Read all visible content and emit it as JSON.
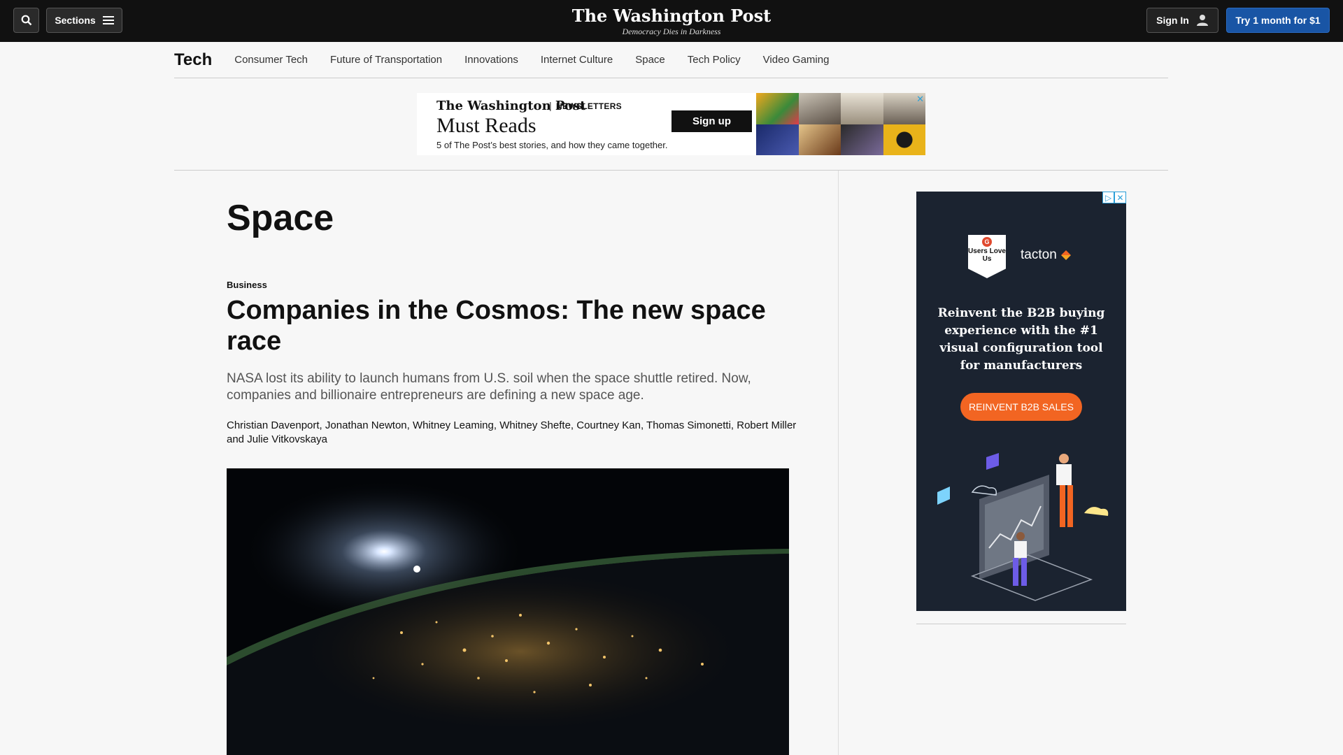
{
  "topbar": {
    "sections_label": "Sections",
    "logo": "The Washington Post",
    "tagline": "Democracy Dies in Darkness",
    "signin_label": "Sign In",
    "subscribe_label": "Try 1 month for $1"
  },
  "subnav": {
    "section": "Tech",
    "links": [
      "Consumer Tech",
      "Future of Transportation",
      "Innovations",
      "Internet Culture",
      "Space",
      "Tech Policy",
      "Video Gaming"
    ]
  },
  "newsletter_ad": {
    "logo": "The Washington Post",
    "separator": "|",
    "label": "NEWSLETTERS",
    "title": "Must Reads",
    "description": "5 of The Post’s best stories, and how they came together.",
    "signup_label": "Sign up"
  },
  "main": {
    "page_title": "Space",
    "kicker": "Business",
    "headline": "Companies in the Cosmos: The new space race",
    "dek": "NASA lost its ability to launch humans from U.S. soil when the space shuttle retired. Now, companies and billionaire entrepreneurs are defining a new space age.",
    "byline": "Christian Davenport, Jonathan Newton, Whitney Leaming, Whitney Shefte, Courtney Kan, Thomas Simonetti, Robert Miller and Julie Vitkovskaya"
  },
  "side_ad": {
    "badge_g": "G",
    "badge_text": "Users Love Us",
    "brand": "tacton",
    "copy": "Reinvent the B2B buying experience with the #1 visual configuration tool for manufacturers",
    "cta": "REINVENT  B2B SALES"
  },
  "colors": {
    "topbar_bg": "#111111",
    "subscribe_bg": "#1955a5",
    "ad_cta": "#f26522",
    "side_ad_bg": "#1b2330"
  },
  "icons": [
    "search-icon",
    "menu-icon",
    "user-icon",
    "ad-close-icon",
    "adchoices-icon"
  ]
}
